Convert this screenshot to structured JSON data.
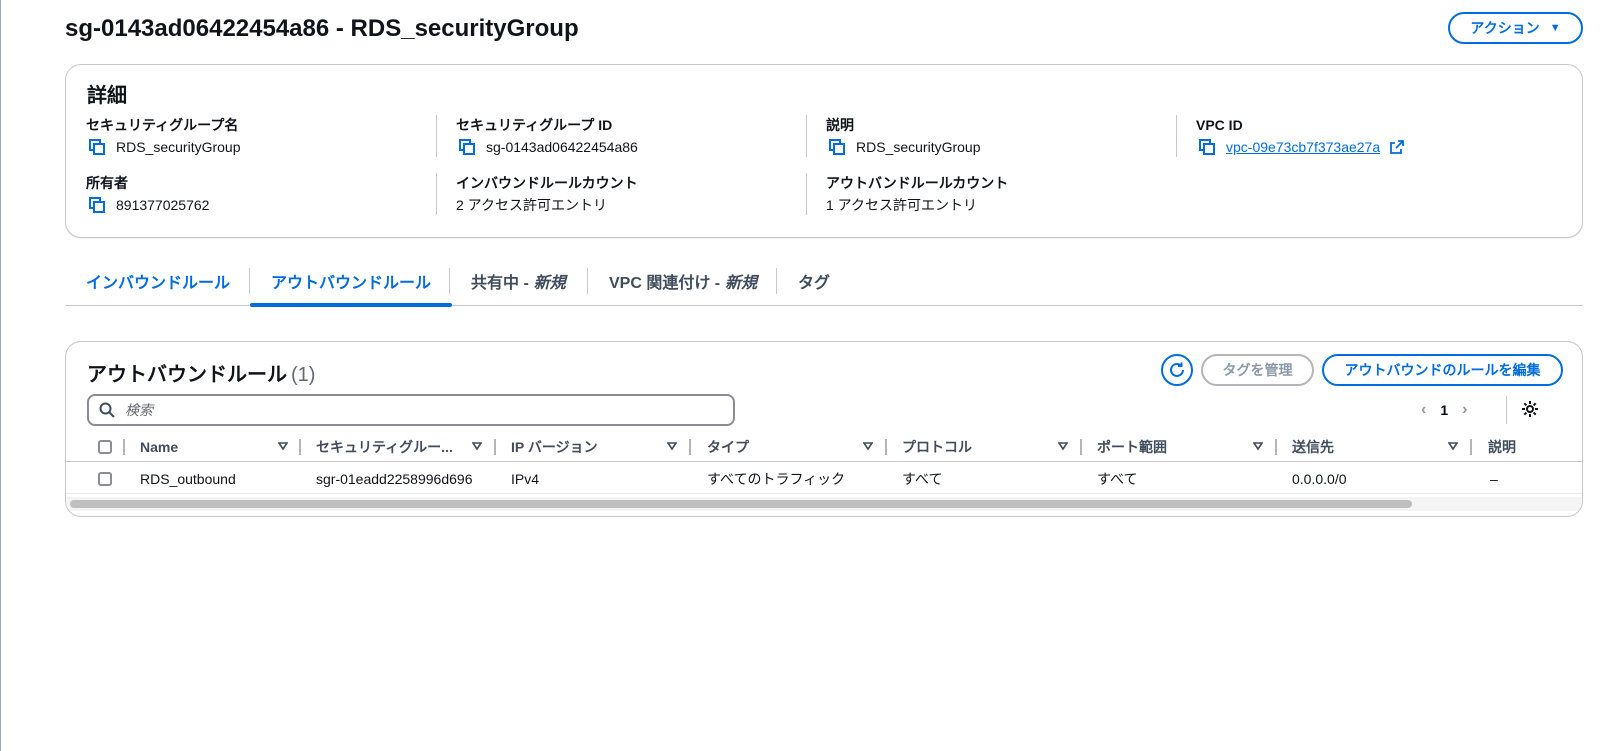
{
  "header": {
    "title": "sg-0143ad06422454a86 - RDS_securityGroup",
    "actions_label": "アクション"
  },
  "details": {
    "heading": "詳細",
    "fields": [
      {
        "label": "セキュリティグループ名",
        "value": "RDS_securityGroup"
      },
      {
        "label": "セキュリティグループ ID",
        "value": "sg-0143ad06422454a86"
      },
      {
        "label": "説明",
        "value": "RDS_securityGroup"
      },
      {
        "label": "VPC ID",
        "value": "vpc-09e73cb7f373ae27a"
      },
      {
        "label": "所有者",
        "value": "891377025762"
      },
      {
        "label": "インバウンドルールカウント",
        "value": "2 アクセス許可エントリ"
      },
      {
        "label": "アウトバンドルールカウント",
        "value": "1 アクセス許可エントリ"
      }
    ]
  },
  "tabs": [
    {
      "label": "インバウンドルール",
      "suffix": ""
    },
    {
      "label": "アウトバウンドルール",
      "suffix": ""
    },
    {
      "label": "共有中 - ",
      "suffix": "新規"
    },
    {
      "label": "VPC 関連付け - ",
      "suffix": "新規"
    },
    {
      "label": "タグ",
      "suffix": ""
    }
  ],
  "rules": {
    "title": "アウトバウンドルール",
    "count": "(1)",
    "manage_tags_label": "タグを管理",
    "edit_label": "アウトバウンドのルールを編集",
    "search_placeholder": "検索",
    "page_number": "1",
    "columns": [
      "Name",
      "セキュリティグルー...",
      "IP バージョン",
      "タイプ",
      "プロトコル",
      "ポート範囲",
      "送信先",
      "説明"
    ],
    "rows": [
      {
        "name": "RDS_outbound",
        "sgr_id": "sgr-01eadd2258996d696",
        "ip_version": "IPv4",
        "type": "すべてのトラフィック",
        "protocol": "すべて",
        "port_range": "すべて",
        "destination": "0.0.0.0/0",
        "description": "–"
      }
    ]
  },
  "colors": {
    "accent": "#006ce0",
    "text": "#0f141a",
    "border": "#c6c6cd",
    "disabled": "#8d99a8"
  }
}
